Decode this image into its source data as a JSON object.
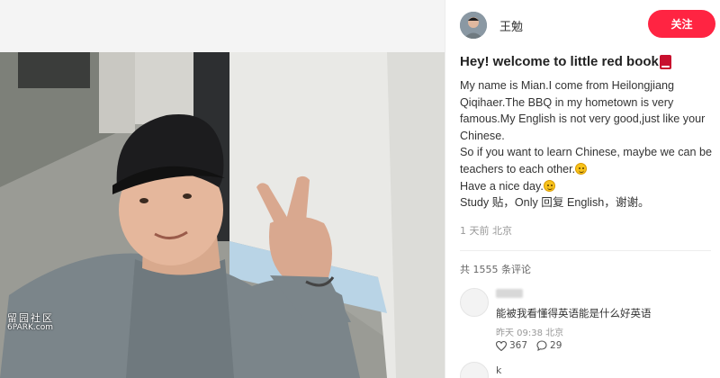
{
  "post": {
    "author_name": "王勉",
    "follow_label": "关注",
    "title": "Hey!  welcome to little red book",
    "title_icon": "red-book-icon",
    "body": {
      "p1": "My name is Mian.I come from Heilongjiang Qiqihaer.The BBQ in my hometown is very famous.My English is not very good,just like your Chinese.",
      "p2": "So if you want to learn Chinese, maybe we can be teachers to each other.",
      "p3": "Have a nice day.",
      "p4": "Study 贴，Only 回复 English，谢谢。"
    },
    "emoji_icon": "smiley-emoji-icon",
    "meta": "1 天前 北京",
    "comments_count": "共 1555 条评论"
  },
  "comments": [
    {
      "username": "",
      "text": "能被我看懂得英语能是什么好英语",
      "time": "昨天 09:38 北京",
      "likes": "367",
      "replies": "29"
    },
    {
      "username": "k",
      "text": "",
      "time": "",
      "likes": "",
      "replies": ""
    }
  ],
  "watermark": {
    "line1": "留园社区",
    "line2": "6PARK.com"
  },
  "colors": {
    "accent": "#ff2442",
    "book_icon": "#c8102e"
  }
}
